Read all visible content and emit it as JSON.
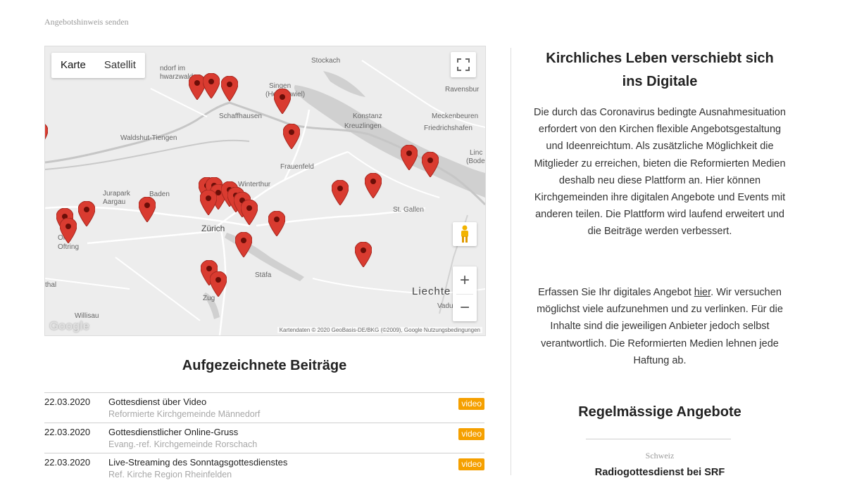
{
  "top_link": "Angebotshinweis senden",
  "map": {
    "type_buttons": [
      "Karte",
      "Satellit"
    ],
    "places": [
      "Stockach",
      "ndorf im",
      "hwarzwald",
      "Singen",
      "(Hohentwiel)",
      "Ravensbur",
      "Schaffhausen",
      "Konstanz",
      "Meckenbeuren",
      "Kreuzlingen",
      "Friedrichshafen",
      "Waldshut-Tiengen",
      "Frauenfeld",
      "Linc",
      "(Bode",
      "Winterthur",
      "Jurapark",
      "Aargau",
      "Baden",
      "St. Gallen",
      "Zürich",
      "Ol",
      "Oftring",
      "thal",
      "Stäfa",
      "Liechte",
      "Vadu",
      "Zug",
      "Willisau"
    ],
    "attribution": "Kartendaten © 2020 GeoBasis-DE/BKG (©2009), Google   Nutzungsbedingungen",
    "logo": "Google"
  },
  "recorded": {
    "title": "Aufgezeichnete Beiträge",
    "rows": [
      {
        "date": "22.03.2020",
        "title": "Gottesdienst über Video",
        "org": "Reformierte Kirchgemeinde Männedorf",
        "badge": "video"
      },
      {
        "date": "22.03.2020",
        "title": "Gottesdienstlicher Online-Gruss",
        "org": "Evang.-ref. Kirchgemeinde Rorschach",
        "badge": "video"
      },
      {
        "date": "22.03.2020",
        "title": "Live-Streaming des Sonntagsgottesdienstes",
        "org": "Ref. Kirche Region Rheinfelden",
        "badge": "video"
      }
    ]
  },
  "right": {
    "title_line1": "Kirchliches Leben verschiebt sich",
    "title_line2": "ins Digitale",
    "body1": "Die durch das Coronavirus bedingte Ausnahmesituation erfordert von den Kirchen flexible Angebotsgestaltung und Ideenreichtum. Als zusätzliche Möglichkeit die Mitglieder zu erreichen, bieten die Reformierten Medien deshalb neu diese Plattform an. Hier können Kirchgemeinden ihre digitalen Angebote und Events mit anderen teilen. Die Plattform wird laufend erweitert und die Beiträge werden verbessert.",
    "body2_pre": "Erfassen Sie Ihr digitales Angebot ",
    "body2_link": "hier",
    "body2_post": ". Wir versuchen möglichst viele aufzunehmen und zu verlinken. Für die Inhalte sind die jeweiligen Anbieter jedoch selbst verantwortlich. Die Reformierten Medien lehnen jede Haftung ab.",
    "regular_title": "Regelmässige Angebote",
    "region": "Schweiz",
    "first_item": "Radiogottesdienst bei SRF"
  },
  "colors": {
    "pin": "#d93b30",
    "badge": "#f5a000",
    "map_bg": "#ececec",
    "lake": "#cfcfcf"
  },
  "icons": [
    "fullscreen-icon",
    "pegman-icon",
    "zoom-in-icon",
    "zoom-out-icon",
    "map-pin-icon"
  ]
}
